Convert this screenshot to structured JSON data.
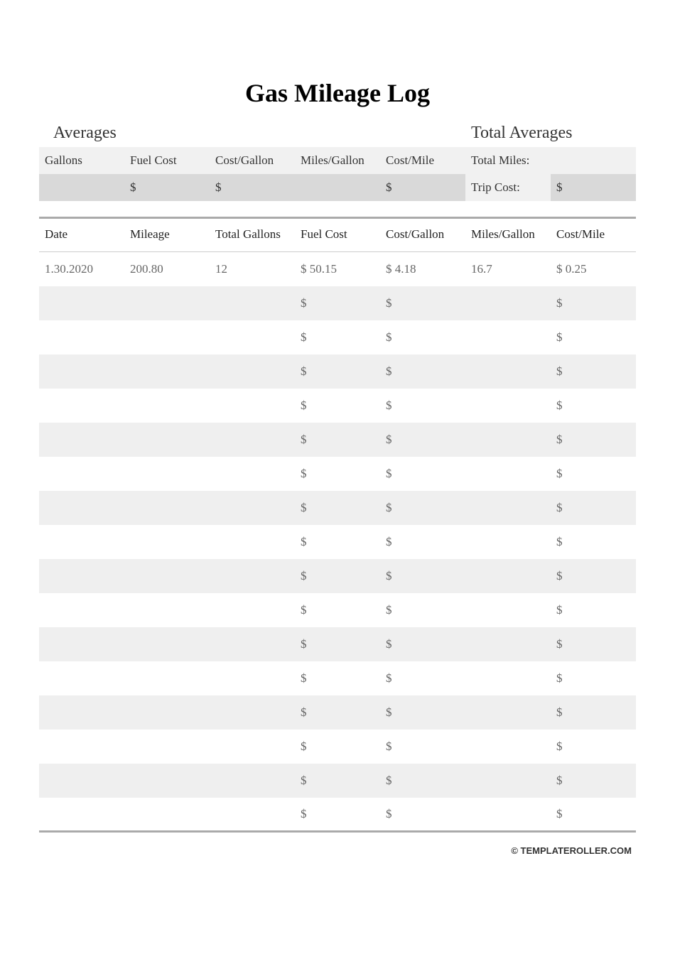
{
  "title": "Gas Mileage Log",
  "averages": {
    "heading_left": "Averages",
    "heading_right": "Total Averages",
    "headers": {
      "gallons": "Gallons",
      "fuel_cost": "Fuel Cost",
      "cost_gallon": "Cost/Gallon",
      "miles_gallon": "Miles/Gallon",
      "cost_mile": "Cost/Mile",
      "total_miles": "Total Miles:",
      "total_miles_value": ""
    },
    "values": {
      "gallons": "",
      "fuel_cost": "$",
      "cost_gallon": "$",
      "miles_gallon": "",
      "cost_mile": "$",
      "trip_cost_label": "Trip Cost:",
      "trip_cost_value": "$"
    }
  },
  "log": {
    "headers": {
      "date": "Date",
      "mileage": "Mileage",
      "total_gallons": "Total Gallons",
      "fuel_cost": "Fuel Cost",
      "cost_gallon": "Cost/Gallon",
      "miles_gallon": "Miles/Gallon",
      "cost_mile": "Cost/Mile"
    },
    "rows": [
      {
        "date": "1.30.2020",
        "mileage": "200.80",
        "total_gallons": "12",
        "fuel_cost": "$ 50.15",
        "cost_gallon": "$ 4.18",
        "miles_gallon": "16.7",
        "cost_mile": "$ 0.25"
      },
      {
        "date": "",
        "mileage": "",
        "total_gallons": "",
        "fuel_cost": "$",
        "cost_gallon": "$",
        "miles_gallon": "",
        "cost_mile": "$"
      },
      {
        "date": "",
        "mileage": "",
        "total_gallons": "",
        "fuel_cost": "$",
        "cost_gallon": "$",
        "miles_gallon": "",
        "cost_mile": "$"
      },
      {
        "date": "",
        "mileage": "",
        "total_gallons": "",
        "fuel_cost": "$",
        "cost_gallon": "$",
        "miles_gallon": "",
        "cost_mile": "$"
      },
      {
        "date": "",
        "mileage": "",
        "total_gallons": "",
        "fuel_cost": "$",
        "cost_gallon": "$",
        "miles_gallon": "",
        "cost_mile": "$"
      },
      {
        "date": "",
        "mileage": "",
        "total_gallons": "",
        "fuel_cost": "$",
        "cost_gallon": "$",
        "miles_gallon": "",
        "cost_mile": "$"
      },
      {
        "date": "",
        "mileage": "",
        "total_gallons": "",
        "fuel_cost": "$",
        "cost_gallon": "$",
        "miles_gallon": "",
        "cost_mile": "$"
      },
      {
        "date": "",
        "mileage": "",
        "total_gallons": "",
        "fuel_cost": "$",
        "cost_gallon": "$",
        "miles_gallon": "",
        "cost_mile": "$"
      },
      {
        "date": "",
        "mileage": "",
        "total_gallons": "",
        "fuel_cost": "$",
        "cost_gallon": "$",
        "miles_gallon": "",
        "cost_mile": "$"
      },
      {
        "date": "",
        "mileage": "",
        "total_gallons": "",
        "fuel_cost": "$",
        "cost_gallon": "$",
        "miles_gallon": "",
        "cost_mile": "$"
      },
      {
        "date": "",
        "mileage": "",
        "total_gallons": "",
        "fuel_cost": "$",
        "cost_gallon": "$",
        "miles_gallon": "",
        "cost_mile": "$"
      },
      {
        "date": "",
        "mileage": "",
        "total_gallons": "",
        "fuel_cost": "$",
        "cost_gallon": "$",
        "miles_gallon": "",
        "cost_mile": "$"
      },
      {
        "date": "",
        "mileage": "",
        "total_gallons": "",
        "fuel_cost": "$",
        "cost_gallon": "$",
        "miles_gallon": "",
        "cost_mile": "$"
      },
      {
        "date": "",
        "mileage": "",
        "total_gallons": "",
        "fuel_cost": "$",
        "cost_gallon": "$",
        "miles_gallon": "",
        "cost_mile": "$"
      },
      {
        "date": "",
        "mileage": "",
        "total_gallons": "",
        "fuel_cost": "$",
        "cost_gallon": "$",
        "miles_gallon": "",
        "cost_mile": "$"
      },
      {
        "date": "",
        "mileage": "",
        "total_gallons": "",
        "fuel_cost": "$",
        "cost_gallon": "$",
        "miles_gallon": "",
        "cost_mile": "$"
      },
      {
        "date": "",
        "mileage": "",
        "total_gallons": "",
        "fuel_cost": "$",
        "cost_gallon": "$",
        "miles_gallon": "",
        "cost_mile": "$"
      }
    ]
  },
  "footer": "© TEMPLATEROLLER.COM"
}
